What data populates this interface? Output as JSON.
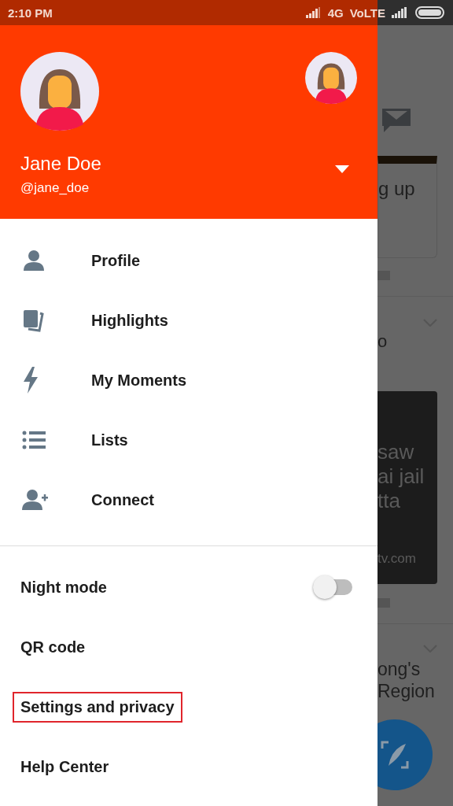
{
  "status_bar": {
    "time": "2:10 PM",
    "network": "4G",
    "volte": "VoLTE"
  },
  "account": {
    "name": "Jane Doe",
    "handle": "@jane_doe"
  },
  "menu": [
    {
      "label": "Profile"
    },
    {
      "label": "Highlights"
    },
    {
      "label": "My Moments"
    },
    {
      "label": "Lists"
    },
    {
      "label": "Connect"
    }
  ],
  "settings": [
    {
      "label": "Night mode",
      "kind": "toggle",
      "on": false,
      "highlighted": false
    },
    {
      "label": "QR code",
      "kind": "link",
      "highlighted": false
    },
    {
      "label": "Settings and privacy",
      "kind": "link",
      "highlighted": true
    },
    {
      "label": "Help Center",
      "kind": "link",
      "highlighted": false
    }
  ],
  "feed_behind": {
    "card_text": "g up",
    "tweet_1": "o",
    "image_lines": [
      "saw",
      "ai jail",
      "tta"
    ],
    "image_source": "tv.com",
    "tweet_2_lines": [
      "ong's",
      "Region"
    ]
  }
}
